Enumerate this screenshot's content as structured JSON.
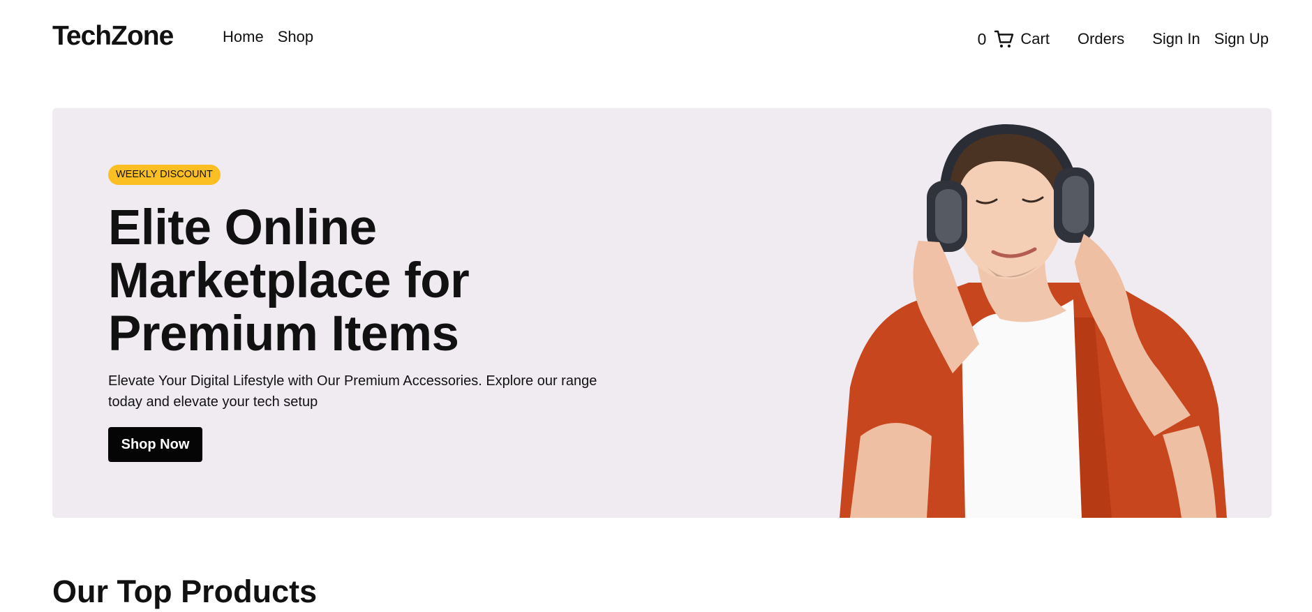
{
  "brand": "TechZone",
  "nav": {
    "home": "Home",
    "shop": "Shop"
  },
  "account_nav": {
    "cart_count": "0",
    "cart": "Cart",
    "orders": "Orders",
    "sign_in": "Sign In",
    "sign_up": "Sign Up"
  },
  "icons": {
    "cart": "shopping-cart-icon",
    "hero_image": "man-with-headphones-image"
  },
  "hero": {
    "badge": "WEEKLY DISCOUNT",
    "headline": "Elite Online Marketplace for Premium Items",
    "subtext": "Elevate Your Digital Lifestyle with Our Premium Accessories. Explore our range today and elevate your tech setup",
    "cta": "Shop Now"
  },
  "section": {
    "title": "Our Top Products"
  },
  "colors": {
    "hero_background": "#efebf1",
    "badge_background": "#fbbf24",
    "button_background": "#050505"
  }
}
